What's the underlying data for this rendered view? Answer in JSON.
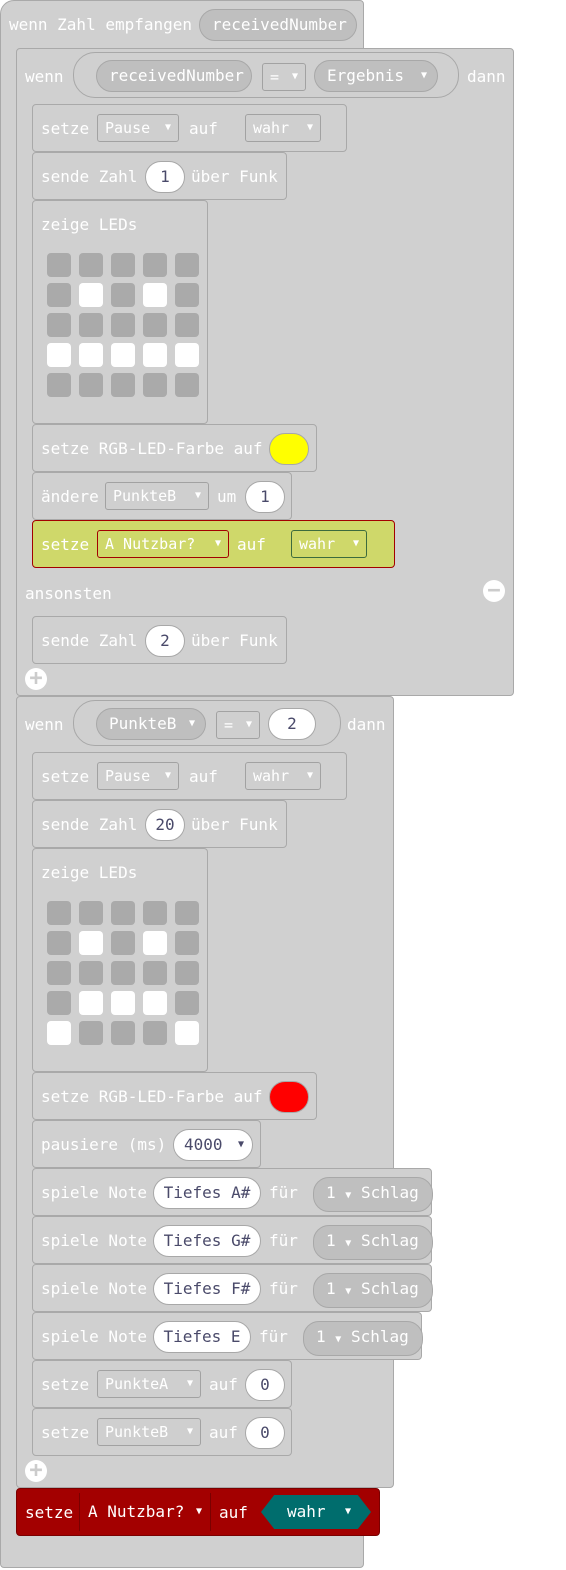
{
  "event": {
    "label": "wenn Zahl empfangen",
    "param": "receivedNumber"
  },
  "if1": {
    "wenn": "wenn",
    "left": "receivedNumber",
    "op": "=",
    "right": "Ergebnis",
    "dann": "dann",
    "s1": {
      "setze": "setze",
      "var": "Pause",
      "auf": "auf",
      "val": "wahr"
    },
    "s2": {
      "pre": "sende Zahl",
      "num": "1",
      "post": "über Funk"
    },
    "s3": {
      "label": "zeige LEDs",
      "grid": [
        [
          0,
          0,
          0,
          0,
          0
        ],
        [
          0,
          1,
          0,
          1,
          0
        ],
        [
          0,
          0,
          0,
          0,
          0
        ],
        [
          1,
          1,
          1,
          1,
          1
        ],
        [
          0,
          0,
          0,
          0,
          0
        ]
      ]
    },
    "s4": {
      "label": "setze RGB-LED-Farbe auf",
      "color": "#ffff00"
    },
    "s5": {
      "pre": "ändere",
      "var": "PunkteB",
      "um": "um",
      "num": "1"
    },
    "s6": {
      "setze": "setze",
      "var": "A Nutzbar?",
      "auf": "auf",
      "val": "wahr"
    },
    "else": "ansonsten",
    "e1": {
      "pre": "sende Zahl",
      "num": "2",
      "post": "über Funk"
    }
  },
  "if2": {
    "wenn": "wenn",
    "left": "PunkteB",
    "op": "=",
    "right": "2",
    "dann": "dann",
    "s1": {
      "setze": "setze",
      "var": "Pause",
      "auf": "auf",
      "val": "wahr"
    },
    "s2": {
      "pre": "sende Zahl",
      "num": "20",
      "post": "über Funk"
    },
    "s3": {
      "label": "zeige LEDs",
      "grid": [
        [
          0,
          0,
          0,
          0,
          0
        ],
        [
          0,
          1,
          0,
          1,
          0
        ],
        [
          0,
          0,
          0,
          0,
          0
        ],
        [
          0,
          1,
          1,
          1,
          0
        ],
        [
          1,
          0,
          0,
          0,
          1
        ]
      ]
    },
    "s4": {
      "label": "setze RGB-LED-Farbe auf",
      "color": "#ff0000"
    },
    "s5": {
      "label": "pausiere (ms)",
      "val": "4000"
    },
    "notes": [
      {
        "pre": "spiele Note",
        "note": "Tiefes A#",
        "fuer": "für",
        "beat": "1",
        "schlag": "Schlag"
      },
      {
        "pre": "spiele Note",
        "note": "Tiefes G#",
        "fuer": "für",
        "beat": "1",
        "schlag": "Schlag"
      },
      {
        "pre": "spiele Note",
        "note": "Tiefes F#",
        "fuer": "für",
        "beat": "1",
        "schlag": "Schlag"
      },
      {
        "pre": "spiele Note",
        "note": "Tiefes E",
        "fuer": "für",
        "beat": "1",
        "schlag": "Schlag"
      }
    ],
    "s10": {
      "setze": "setze",
      "var": "PunkteA",
      "auf": "auf",
      "num": "0"
    },
    "s11": {
      "setze": "setze",
      "var": "PunkteB",
      "auf": "auf",
      "num": "0"
    }
  },
  "final": {
    "setze": "setze",
    "var": "A Nutzbar?",
    "auf": "auf",
    "val": "wahr"
  },
  "colors": {
    "block": "#d0d0d0",
    "highlight": "#cfd86a",
    "final": "#a30000",
    "bool": "#006d6d"
  }
}
